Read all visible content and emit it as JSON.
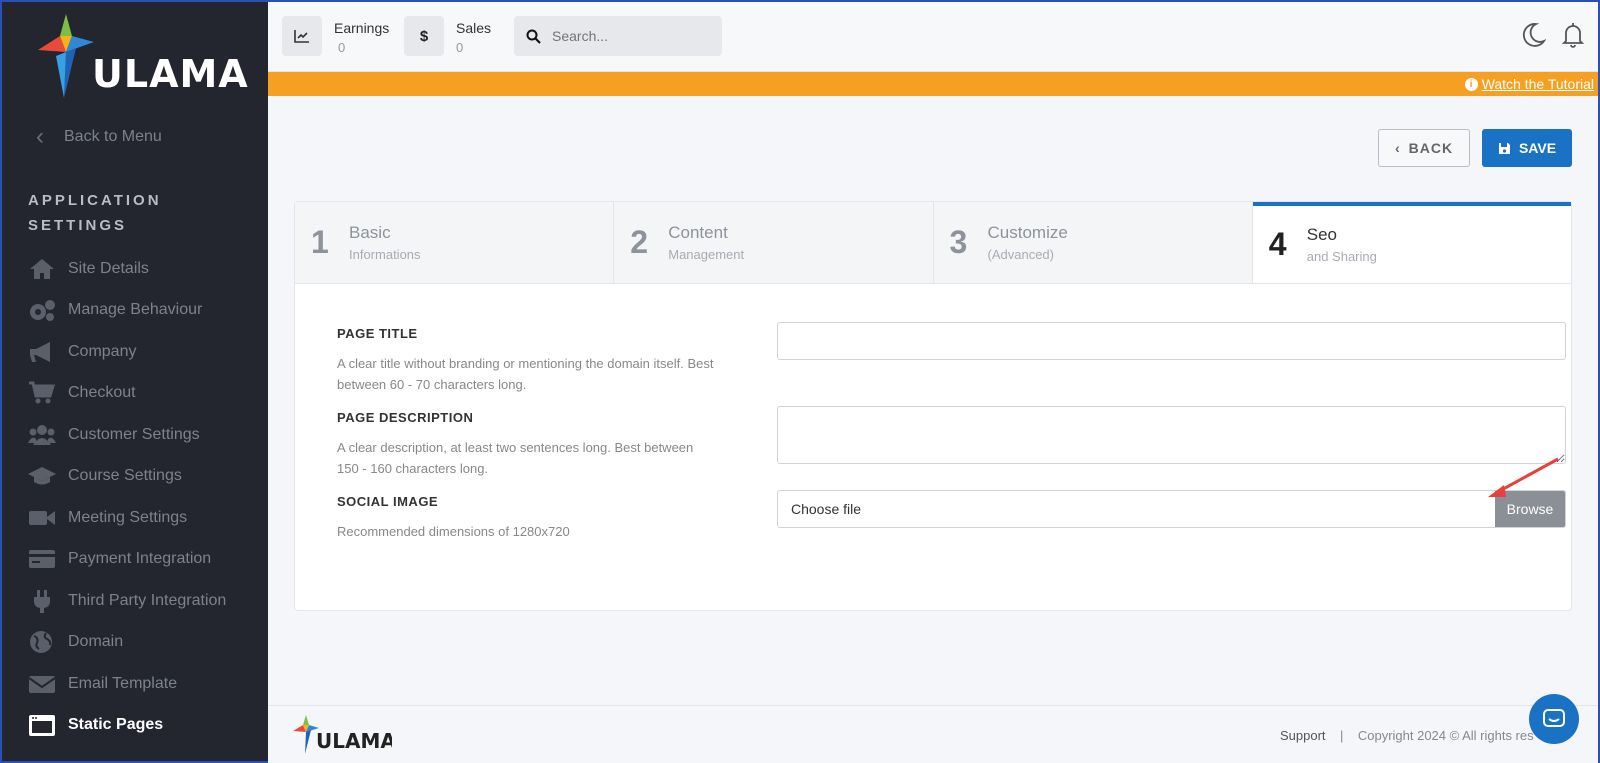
{
  "brand": {
    "name": "ULAMA"
  },
  "sidebar": {
    "back_label": "Back to Menu",
    "section_title": "APPLICATION SETTINGS",
    "items": [
      {
        "label": "Site Details",
        "icon": "home-icon"
      },
      {
        "label": "Manage Behaviour",
        "icon": "gears-icon"
      },
      {
        "label": "Company",
        "icon": "megaphone-icon"
      },
      {
        "label": "Checkout",
        "icon": "cart-icon"
      },
      {
        "label": "Customer Settings",
        "icon": "users-icon"
      },
      {
        "label": "Course Settings",
        "icon": "graduation-cap-icon"
      },
      {
        "label": "Meeting Settings",
        "icon": "video-icon"
      },
      {
        "label": "Payment Integration",
        "icon": "credit-card-icon"
      },
      {
        "label": "Third Party Integration",
        "icon": "plug-icon"
      },
      {
        "label": "Domain",
        "icon": "globe-icon"
      },
      {
        "label": "Email Template",
        "icon": "envelope-icon"
      },
      {
        "label": "Static Pages",
        "icon": "window-icon",
        "active": true
      }
    ]
  },
  "topbar": {
    "earnings_label": "Earnings",
    "earnings_value": "0",
    "sales_label": "Sales",
    "sales_value": "0",
    "sales_icon_glyph": "$",
    "search_placeholder": "Search..."
  },
  "banner": {
    "tutorial_link": "Watch the Tutorial"
  },
  "actions": {
    "back_label": "BACK",
    "save_label": "SAVE"
  },
  "steps": [
    {
      "num": "1",
      "title": "Basic",
      "subtitle": "Informations"
    },
    {
      "num": "2",
      "title": "Content",
      "subtitle": "Management"
    },
    {
      "num": "3",
      "title": "Customize",
      "subtitle": "(Advanced)"
    },
    {
      "num": "4",
      "title": "Seo",
      "subtitle": "and Sharing",
      "active": true
    }
  ],
  "form": {
    "page_title_label": "PAGE TITLE",
    "page_title_desc": "A clear title without branding or mentioning the domain itself. Best between 60 - 70 characters long.",
    "page_title_value": "",
    "page_desc_label": "PAGE DESCRIPTION",
    "page_desc_desc": "A clear description, at least two sentences long. Best between 150 - 160 characters long.",
    "page_desc_value": "",
    "social_image_label": "SOCIAL IMAGE",
    "social_image_desc": "Recommended dimensions of 1280x720",
    "choose_file": "Choose file",
    "browse_label": "Browse"
  },
  "footer": {
    "support": "Support",
    "separator": "|",
    "copyright": "Copyright 2024 © All rights res"
  },
  "colors": {
    "primary": "#1a72c5",
    "banner": "#f5a022",
    "sidebar": "#23252f"
  }
}
